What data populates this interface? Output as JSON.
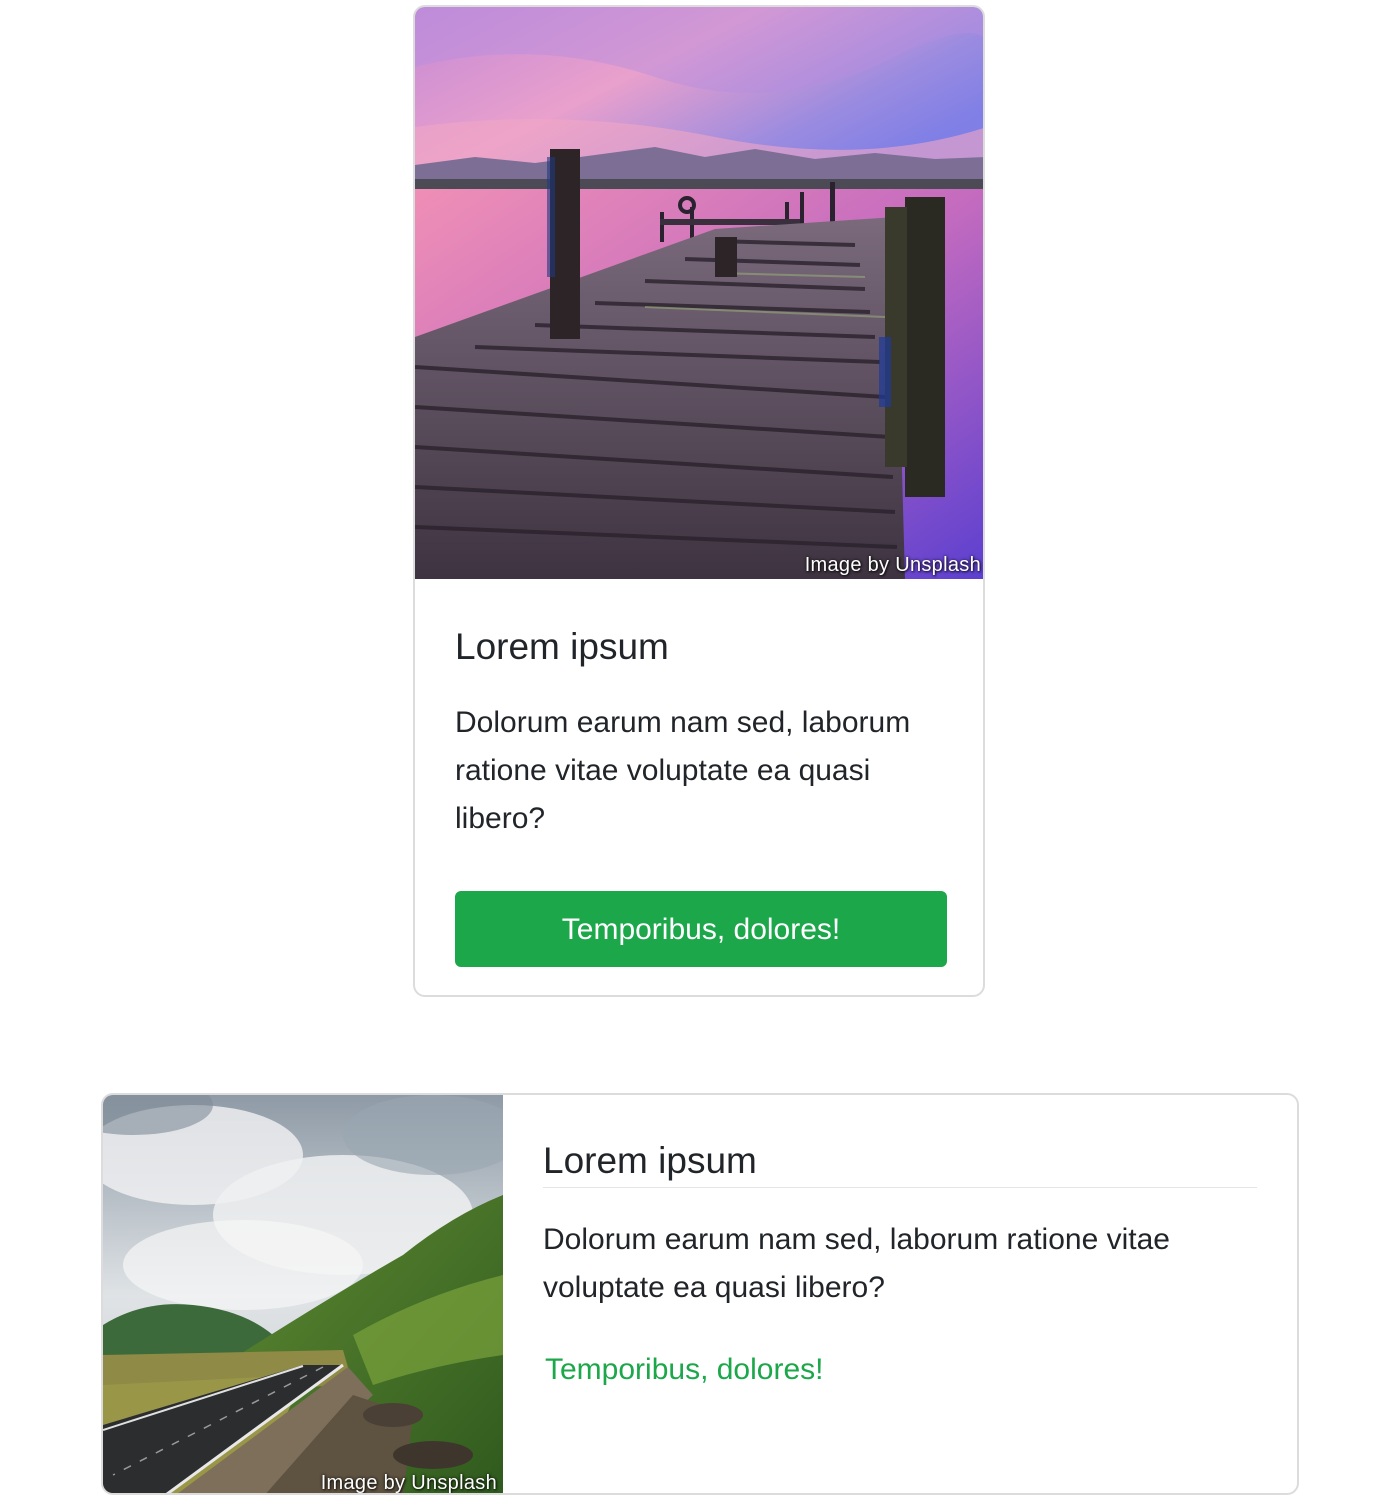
{
  "cards": [
    {
      "image_alt": "Wooden pier over a lake at pink sunset",
      "image_caption": "Image by Unsplash",
      "title": "Lorem ipsum",
      "text": "Dolorum earum nam sed, laborum ratione vitae voluptate ea quasi libero?",
      "button_label": "Temporibus, dolores!"
    },
    {
      "image_alt": "Road through green mountain valley under cloudy sky",
      "image_caption": "Image by Unsplash",
      "title": "Lorem ipsum",
      "text": "Dolorum earum nam sed, laborum ratione vitae voluptate ea quasi libero?",
      "link_label": "Temporibus, dolores!"
    }
  ],
  "colors": {
    "accent": "#1ca74a",
    "border": "#dcdcdc",
    "text": "#212529"
  }
}
